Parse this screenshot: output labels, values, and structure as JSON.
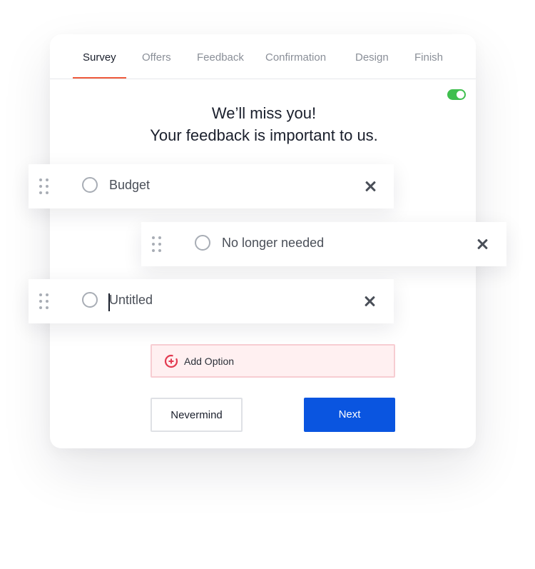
{
  "tabs": [
    {
      "label": "Survey",
      "active": true
    },
    {
      "label": "Offers",
      "active": false
    },
    {
      "label": "Feedback",
      "active": false
    },
    {
      "label": "Confirmation",
      "active": false
    },
    {
      "label": "Design",
      "active": false
    },
    {
      "label": "Finish",
      "active": false
    }
  ],
  "toggle": {
    "on": true,
    "color": "#3fbf4e"
  },
  "headline": {
    "line1": "We’ll miss you!",
    "line2": "Your feedback is important to us."
  },
  "options": [
    {
      "label": "Budget"
    },
    {
      "label": "No longer needed"
    },
    {
      "value": "Untitled"
    }
  ],
  "add_option": {
    "label": "Add Option"
  },
  "buttons": {
    "nevermind": "Nevermind",
    "next": "Next"
  },
  "colors": {
    "accent": "#ef5a3c",
    "primary": "#0a55e0",
    "add_option_bg": "#fff0f1"
  }
}
